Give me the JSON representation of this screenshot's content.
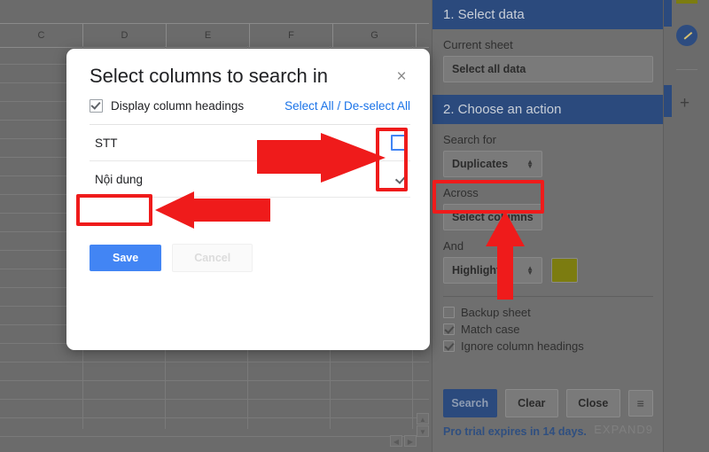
{
  "sheet": {
    "column_headers": [
      "C",
      "D",
      "E",
      "F",
      "G",
      ""
    ],
    "watermark": ""
  },
  "sidebar": {
    "step1_title": "1. Select data",
    "current_sheet_label": "Current sheet",
    "select_all_data": "Select all data",
    "step2_title": "2. Choose an action",
    "search_for_label": "Search for",
    "search_for_value": "Duplicates",
    "across_label": "Across",
    "select_columns_value": "Select columns",
    "and_label": "And",
    "and_value": "Highlight",
    "highlight_color": "#7c7c10",
    "options": [
      {
        "label": "Backup sheet",
        "checked": false
      },
      {
        "label": "Match case",
        "checked": true
      },
      {
        "label": "Ignore column headings",
        "checked": true
      }
    ],
    "buttons": {
      "search": "Search",
      "clear": "Clear",
      "close": "Close",
      "menu": "≡"
    },
    "trial_notice": "Pro trial expires in 14 days.",
    "brand": "EXPAND9"
  },
  "dialog": {
    "title": "Select columns to search in",
    "close_icon": "×",
    "display_headings_label": "Display column headings",
    "display_headings_checked": true,
    "select_all_link": "Select All",
    "link_separator": "/",
    "deselect_all_link": "De-select All",
    "columns": [
      {
        "name": "STT",
        "checked": false,
        "focused": true
      },
      {
        "name": "Nội dung",
        "checked": true,
        "focused": false
      }
    ],
    "save_label": "Save",
    "cancel_label": "Cancel"
  },
  "annotations": {
    "accent_color": "#ef1b1b",
    "boxes": [
      "checkbox-column",
      "save-button",
      "select-columns-field"
    ],
    "arrows": [
      "arrow-to-checkboxes",
      "arrow-to-save",
      "arrow-to-select-columns"
    ]
  },
  "rail": {
    "check_icon": "check-circle-icon",
    "add_icon": "+"
  }
}
